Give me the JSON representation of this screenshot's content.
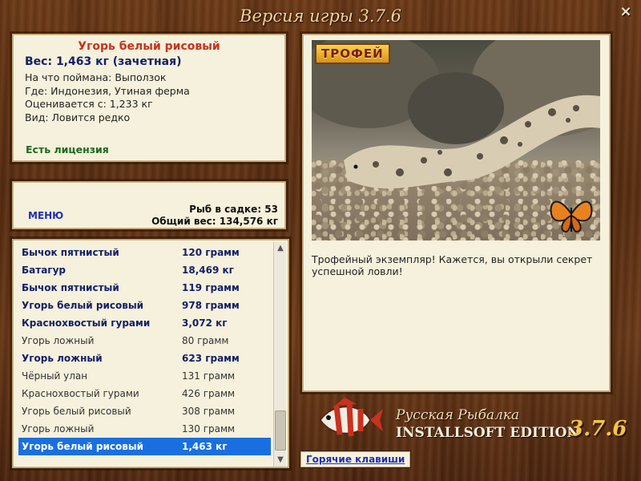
{
  "window": {
    "title": "Версия игры 3.7.6",
    "close_label": "×"
  },
  "info": {
    "fish_name": "Угорь белый рисовый",
    "weight": "Вес: 1,463 кг (зачетная)",
    "lines": [
      "На что поймана: Выползок",
      "Где: Индонезия, Утиная ферма",
      "Оценивается с: 1,233 кг",
      "Вид: Ловится редко"
    ],
    "license": "Есть лицензия"
  },
  "mid": {
    "menu_label": "МЕНЮ",
    "fish_count": "Рыб в садке: 53",
    "total_weight": "Общий вес: 134,576 кг"
  },
  "catch_list": [
    {
      "name": "Бычок пятнистый",
      "weight": "120 грамм",
      "style": "bold"
    },
    {
      "name": "Батагур",
      "weight": "18,469 кг",
      "style": "bold"
    },
    {
      "name": "Бычок пятнистый",
      "weight": "119 грамм",
      "style": "bold"
    },
    {
      "name": "Угорь белый рисовый",
      "weight": "978 грамм",
      "style": "bold"
    },
    {
      "name": "Краснохвостый гурами",
      "weight": "3,072 кг",
      "style": "bold"
    },
    {
      "name": "Угорь ложный",
      "weight": "80 грамм",
      "style": "norm"
    },
    {
      "name": "Угорь ложный",
      "weight": "623 грамм",
      "style": "bold"
    },
    {
      "name": "Чёрный улан",
      "weight": "131 грамм",
      "style": "norm"
    },
    {
      "name": "Краснохвостый гурами",
      "weight": "426 грамм",
      "style": "norm"
    },
    {
      "name": "Угорь белый рисовый",
      "weight": "308 грамм",
      "style": "norm"
    },
    {
      "name": "Угорь ложный",
      "weight": "130 грамм",
      "style": "norm"
    },
    {
      "name": "Угорь белый рисовый",
      "weight": "1,463 кг",
      "style": "sel"
    }
  ],
  "photo": {
    "badge": "ТРОФЕЙ",
    "caption": "Трофейный экземпляр! Кажется, вы открыли секрет успешной ловли!"
  },
  "brand": {
    "line1": "Русская Рыбалка",
    "line2": "INSTALLSOFT EDITION",
    "version": "3.7.6"
  },
  "hotkeys_label": "Горячие клавиши",
  "colors": {
    "accent_blue": "#1e2fb8",
    "selection": "#1a6fe0",
    "title_red": "#c8321e",
    "license_green": "#1c6a1c"
  }
}
